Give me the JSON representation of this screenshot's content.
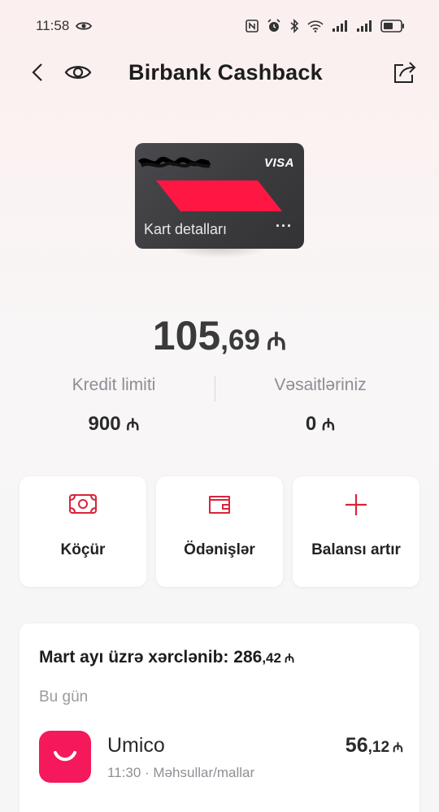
{
  "status_bar": {
    "time": "11:58"
  },
  "header": {
    "title": "Birbank Cashback"
  },
  "card": {
    "brand": "VISA",
    "details_label": "Kart detalları",
    "more_label": "···",
    "accent_color": "#ff1744"
  },
  "balance": {
    "integer": "105",
    "decimal": ",69",
    "currency": "₼"
  },
  "limits": {
    "credit_label": "Kredit limiti",
    "credit_value": "900",
    "own_label": "Vəsaitləriniz",
    "own_value": "0",
    "currency": "₼"
  },
  "actions": [
    {
      "label": "Köçür",
      "icon": "cash-transfer-icon"
    },
    {
      "label": "Ödənişlər",
      "icon": "wallet-icon"
    },
    {
      "label": "Balansı artır",
      "icon": "plus-icon"
    }
  ],
  "spending": {
    "title_prefix": "Mart ayı üzrə xərclənib: ",
    "total_integer": "286",
    "total_decimal": ",42",
    "currency": "₼",
    "day_label": "Bu gün",
    "transactions": [
      {
        "name": "Umico",
        "time": "11:30",
        "separator": "·",
        "category": "Məhsullar/mallar",
        "amount_integer": "56",
        "amount_decimal": ",12",
        "currency": "₼",
        "logo_color": "#f5195c"
      }
    ]
  },
  "colors": {
    "accent": "#d9243a",
    "text_dark": "#222222",
    "text_muted": "#8d8d95"
  }
}
